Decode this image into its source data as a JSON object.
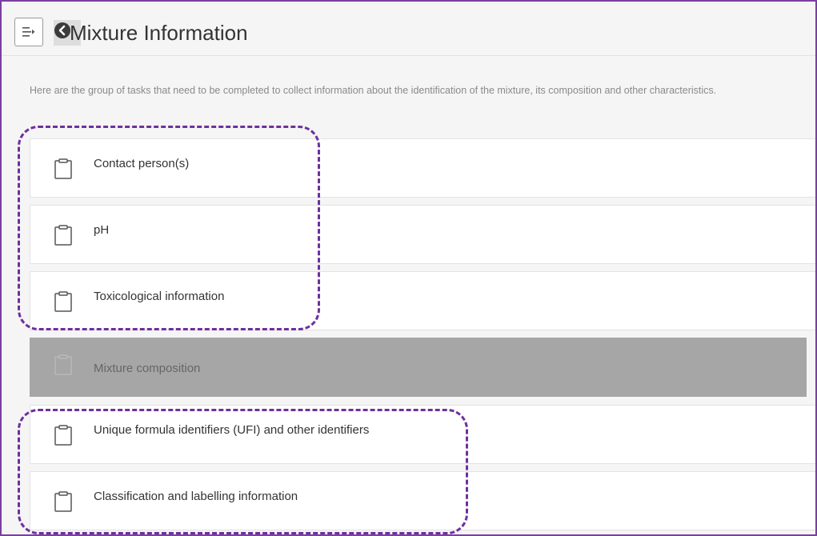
{
  "header": {
    "title": "Mixture Information",
    "menu_icon": "menu-collapse-icon",
    "back_icon": "chevron-left-circle-icon"
  },
  "intro": "Here are the group of tasks that need to be completed to collect information about the identification of the mixture, its composition and other characteristics.",
  "tasks": [
    {
      "label": "Contact person(s)",
      "icon": "clipboard-icon",
      "enabled": true
    },
    {
      "label": "pH",
      "icon": "clipboard-icon",
      "enabled": true
    },
    {
      "label": "Toxicological information",
      "icon": "clipboard-icon",
      "enabled": true
    },
    {
      "label": "Mixture composition",
      "icon": "clipboard-icon",
      "enabled": false
    },
    {
      "label": "Unique formula identifiers (UFI) and other identifiers",
      "icon": "clipboard-icon",
      "enabled": true
    },
    {
      "label": "Classification and labelling information",
      "icon": "clipboard-icon",
      "enabled": true
    }
  ],
  "colors": {
    "highlight": "#6f2f9f",
    "frame": "#7b3fa0",
    "disabled_bg": "#a6a6a6",
    "background": "#f5f5f5"
  }
}
